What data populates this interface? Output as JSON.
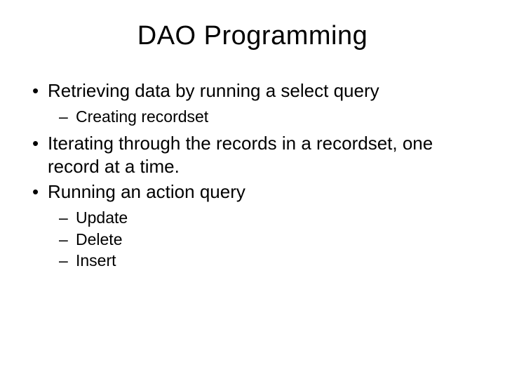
{
  "title": "DAO Programming",
  "bullets": [
    {
      "text": "Retrieving data by running a select query",
      "sub": [
        "Creating recordset"
      ]
    },
    {
      "text": "Iterating through the records in a recordset, one record at a time.",
      "sub": []
    },
    {
      "text": "Running an action query",
      "sub": [
        "Update",
        "Delete",
        "Insert"
      ]
    }
  ]
}
